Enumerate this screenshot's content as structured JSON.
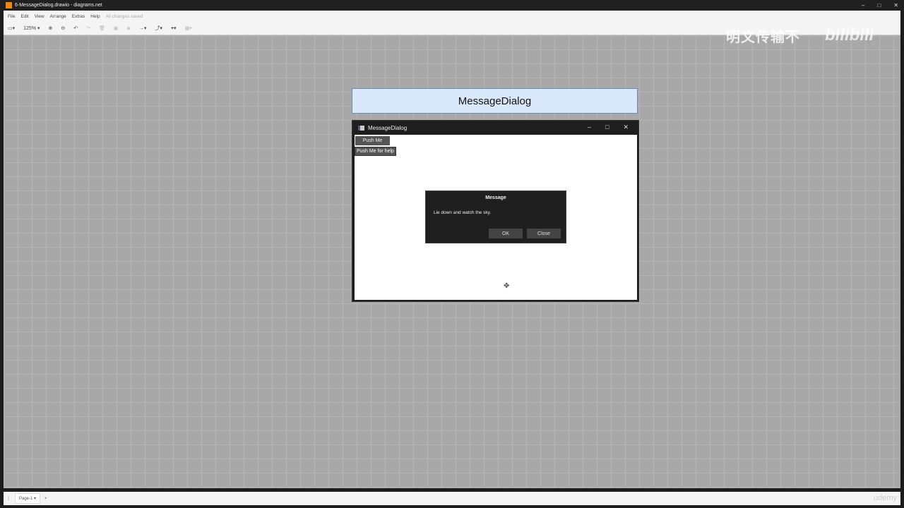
{
  "window": {
    "title": "6-MessageDialog.drawio - diagrams.net",
    "min": "–",
    "max": "□",
    "close": "✕"
  },
  "menu": [
    "File",
    "Edit",
    "View",
    "Arrange",
    "Extras",
    "Help"
  ],
  "menu_status": "All changes saved",
  "toolbar": {
    "zoom": "125%"
  },
  "watermark": {
    "text": "明文传输不",
    "brand": "bilibili"
  },
  "diagram": {
    "header": "MessageDialog"
  },
  "app": {
    "title": "MessageDialog",
    "push_button": "Push Me",
    "tooltip": "Push Me for help",
    "dialog": {
      "title": "Message",
      "message": "Lie down and watch the sky.",
      "ok": "OK",
      "close": "Close"
    }
  },
  "footer": {
    "page": "Page-1",
    "add": "+",
    "brand": "udemy"
  }
}
